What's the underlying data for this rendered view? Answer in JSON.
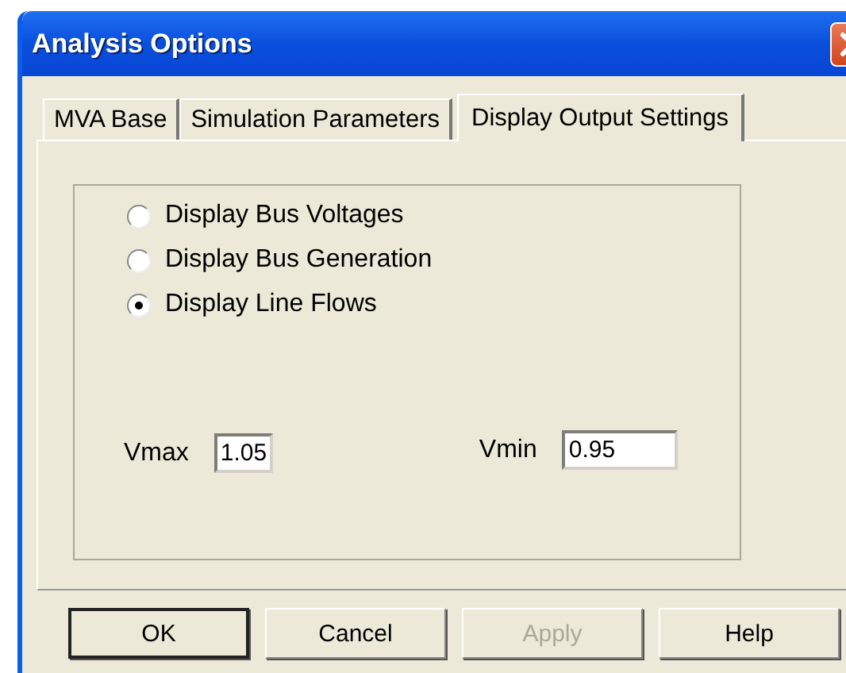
{
  "window": {
    "title": "Analysis Options"
  },
  "tabs": [
    {
      "label": "MVA Base",
      "selected": false
    },
    {
      "label": "Simulation Parameters",
      "selected": false
    },
    {
      "label": "Display Output Settings",
      "selected": true
    }
  ],
  "options": [
    {
      "label": "Display Bus Voltages",
      "selected": false
    },
    {
      "label": "Display Bus Generation",
      "selected": false
    },
    {
      "label": "Display Line Flows",
      "selected": true
    }
  ],
  "fields": [
    {
      "label": "Vmax",
      "value": "1.05"
    },
    {
      "label": "Vmin",
      "value": "0.95"
    }
  ],
  "buttons": [
    {
      "label": "OK",
      "default": true,
      "disabled": false
    },
    {
      "label": "Cancel",
      "default": false,
      "disabled": false
    },
    {
      "label": "Apply",
      "default": false,
      "disabled": true
    },
    {
      "label": "Help",
      "default": false,
      "disabled": false
    }
  ]
}
